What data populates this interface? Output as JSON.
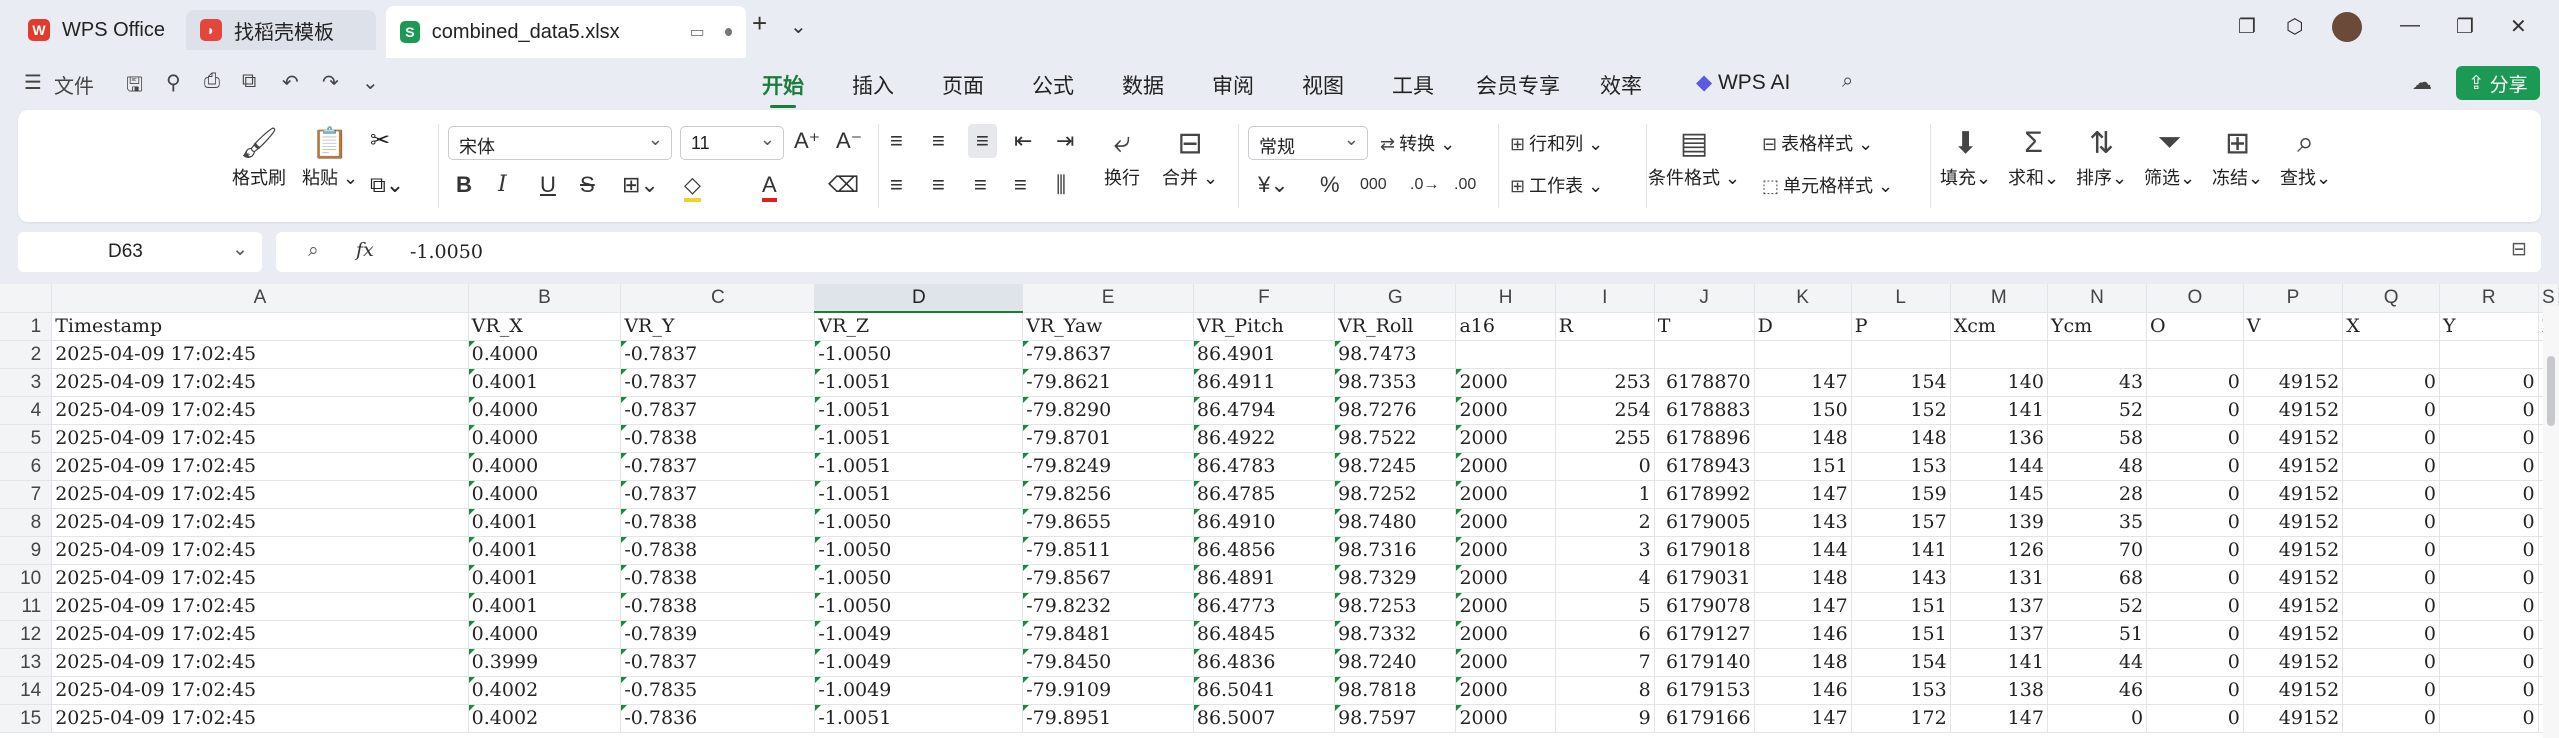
{
  "tabs": [
    {
      "label": "WPS Office",
      "icon": "wps-logo-icon"
    },
    {
      "label": "找稻壳模板",
      "icon": "docer-icon"
    },
    {
      "label": "combined_data5.xlsx",
      "icon": "spreadsheet-icon"
    }
  ],
  "menu": {
    "file": "文件",
    "tabs": [
      "开始",
      "插入",
      "页面",
      "公式",
      "数据",
      "审阅",
      "视图",
      "工具",
      "会员专享",
      "效率",
      "WPS AI"
    ],
    "share": "分享"
  },
  "ribbon": {
    "format_painter": "格式刷",
    "paste": "粘贴",
    "font_name": "宋体",
    "font_size": "11",
    "wrap": "换行",
    "merge": "合并",
    "number_format": "常规",
    "convert": "转换",
    "rows_cols": "行和列",
    "worksheet": "工作表",
    "conditional_format": "条件格式",
    "table_style": "表格样式",
    "cell_style": "单元格样式",
    "fill": "填充",
    "sum": "求和",
    "sort": "排序",
    "filter": "筛选",
    "freeze": "冻结",
    "find": "查找",
    "accent": "#1c7d3a"
  },
  "formula_bar": {
    "cell_ref": "D63",
    "fx": "fx",
    "value": "-1.0050"
  },
  "columns": [
    "A",
    "B",
    "C",
    "D",
    "E",
    "F",
    "G",
    "H",
    "I",
    "J",
    "K",
    "L",
    "M",
    "N",
    "O",
    "P",
    "Q",
    "R",
    "S"
  ],
  "rows": [
    {
      "n": "1",
      "c": [
        "Timestamp",
        "VR_X",
        "VR_Y",
        "VR_Z",
        "VR_Yaw",
        "VR_Pitch",
        "VR_Roll",
        "a16",
        "R",
        "T",
        "D",
        "P",
        "Xcm",
        "Ycm",
        "O",
        "V",
        "X",
        "Y",
        "Z"
      ]
    },
    {
      "n": "2",
      "c": [
        "2025-04-09 17:02:45",
        "0.4000",
        "-0.7837",
        "-1.0050",
        "-79.8637",
        "86.4901",
        "98.7473",
        "",
        "",
        "",
        "",
        "",
        "",
        "",
        "",
        "",
        "",
        "",
        ""
      ]
    },
    {
      "n": "3",
      "c": [
        "2025-04-09 17:02:45",
        "0.4001",
        "-0.7837",
        "-1.0051",
        "-79.8621",
        "86.4911",
        "98.7353",
        "2000",
        "253",
        "6178870",
        "147",
        "154",
        "140",
        "43",
        "0",
        "49152",
        "0",
        "0",
        ""
      ]
    },
    {
      "n": "4",
      "c": [
        "2025-04-09 17:02:45",
        "0.4000",
        "-0.7837",
        "-1.0051",
        "-79.8290",
        "86.4794",
        "98.7276",
        "2000",
        "254",
        "6178883",
        "150",
        "152",
        "141",
        "52",
        "0",
        "49152",
        "0",
        "0",
        ""
      ]
    },
    {
      "n": "5",
      "c": [
        "2025-04-09 17:02:45",
        "0.4000",
        "-0.7838",
        "-1.0051",
        "-79.8701",
        "86.4922",
        "98.7522",
        "2000",
        "255",
        "6178896",
        "148",
        "148",
        "136",
        "58",
        "0",
        "49152",
        "0",
        "0",
        ""
      ]
    },
    {
      "n": "6",
      "c": [
        "2025-04-09 17:02:45",
        "0.4000",
        "-0.7837",
        "-1.0051",
        "-79.8249",
        "86.4783",
        "98.7245",
        "2000",
        "0",
        "6178943",
        "151",
        "153",
        "144",
        "48",
        "0",
        "49152",
        "0",
        "0",
        ""
      ]
    },
    {
      "n": "7",
      "c": [
        "2025-04-09 17:02:45",
        "0.4000",
        "-0.7837",
        "-1.0051",
        "-79.8256",
        "86.4785",
        "98.7252",
        "2000",
        "1",
        "6178992",
        "147",
        "159",
        "145",
        "28",
        "0",
        "49152",
        "0",
        "0",
        ""
      ]
    },
    {
      "n": "8",
      "c": [
        "2025-04-09 17:02:45",
        "0.4001",
        "-0.7838",
        "-1.0050",
        "-79.8655",
        "86.4910",
        "98.7480",
        "2000",
        "2",
        "6179005",
        "143",
        "157",
        "139",
        "35",
        "0",
        "49152",
        "0",
        "0",
        ""
      ]
    },
    {
      "n": "9",
      "c": [
        "2025-04-09 17:02:45",
        "0.4001",
        "-0.7838",
        "-1.0050",
        "-79.8511",
        "86.4856",
        "98.7316",
        "2000",
        "3",
        "6179018",
        "144",
        "141",
        "126",
        "70",
        "0",
        "49152",
        "0",
        "0",
        ""
      ]
    },
    {
      "n": "10",
      "c": [
        "2025-04-09 17:02:45",
        "0.4001",
        "-0.7838",
        "-1.0050",
        "-79.8567",
        "86.4891",
        "98.7329",
        "2000",
        "4",
        "6179031",
        "148",
        "143",
        "131",
        "68",
        "0",
        "49152",
        "0",
        "0",
        ""
      ]
    },
    {
      "n": "11",
      "c": [
        "2025-04-09 17:02:45",
        "0.4001",
        "-0.7838",
        "-1.0050",
        "-79.8232",
        "86.4773",
        "98.7253",
        "2000",
        "5",
        "6179078",
        "147",
        "151",
        "137",
        "52",
        "0",
        "49152",
        "0",
        "0",
        ""
      ]
    },
    {
      "n": "12",
      "c": [
        "2025-04-09 17:02:45",
        "0.4000",
        "-0.7839",
        "-1.0049",
        "-79.8481",
        "86.4845",
        "98.7332",
        "2000",
        "6",
        "6179127",
        "146",
        "151",
        "137",
        "51",
        "0",
        "49152",
        "0",
        "0",
        ""
      ]
    },
    {
      "n": "13",
      "c": [
        "2025-04-09 17:02:45",
        "0.3999",
        "-0.7837",
        "-1.0049",
        "-79.8450",
        "86.4836",
        "98.7240",
        "2000",
        "7",
        "6179140",
        "148",
        "154",
        "141",
        "44",
        "0",
        "49152",
        "0",
        "0",
        ""
      ]
    },
    {
      "n": "14",
      "c": [
        "2025-04-09 17:02:45",
        "0.4002",
        "-0.7835",
        "-1.0049",
        "-79.9109",
        "86.5041",
        "98.7818",
        "2000",
        "8",
        "6179153",
        "146",
        "153",
        "138",
        "46",
        "0",
        "49152",
        "0",
        "0",
        ""
      ]
    },
    {
      "n": "15",
      "c": [
        "2025-04-09 17:02:45",
        "0.4002",
        "-0.7836",
        "-1.0051",
        "-79.8951",
        "86.5007",
        "98.7597",
        "2000",
        "9",
        "6179166",
        "147",
        "172",
        "147",
        "0",
        "0",
        "49152",
        "0",
        "0",
        ""
      ]
    }
  ]
}
